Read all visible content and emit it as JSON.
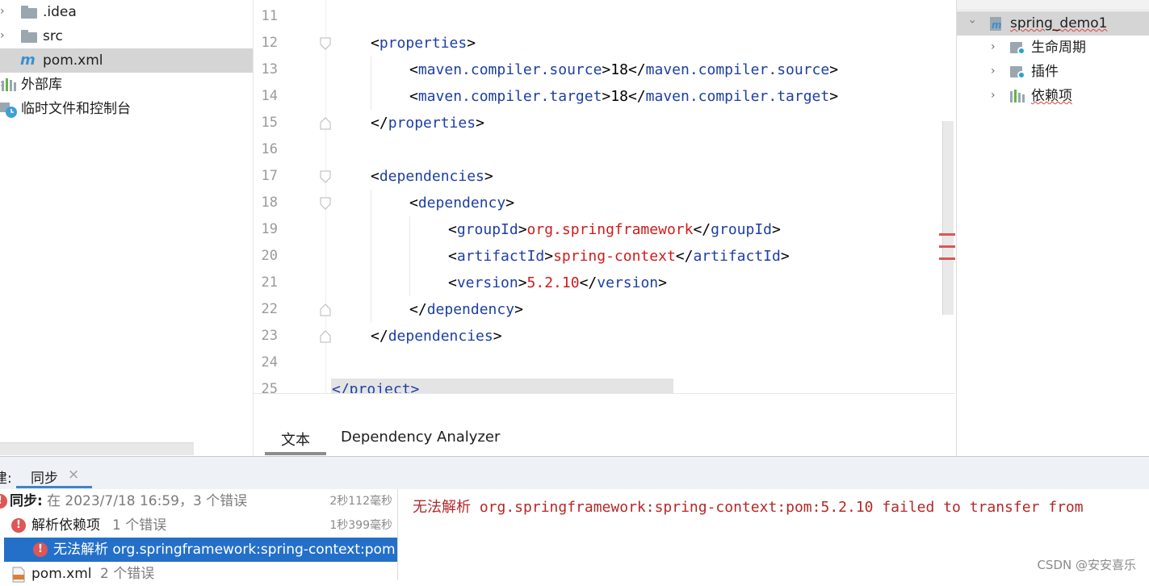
{
  "project_tree": {
    "items": [
      {
        "label": ".idea",
        "icon": "folder-icon"
      },
      {
        "label": "src",
        "icon": "folder-icon"
      },
      {
        "label": "pom.xml",
        "icon": "maven-file-icon"
      },
      {
        "label": "外部库",
        "icon": "library-icon"
      },
      {
        "label": "临时文件和控制台",
        "icon": "scratches-icon"
      }
    ]
  },
  "editor": {
    "line_numbers": [
      "11",
      "12",
      "13",
      "14",
      "15",
      "16",
      "17",
      "18",
      "19",
      "20",
      "21",
      "22",
      "23",
      "24",
      "25"
    ],
    "code": {
      "l12_tag": "properties",
      "l13_tag": "maven.compiler.source",
      "l13_val": "18",
      "l14_tag": "maven.compiler.target",
      "l14_val": "18",
      "l15_tag": "properties",
      "l17_tag": "dependencies",
      "l18_tag": "dependency",
      "l19_tag": "groupId",
      "l19_val": "org.springframework",
      "l20_tag": "artifactId",
      "l20_val": "spring-context",
      "l21_tag": "version",
      "l21_val": "5.2.10",
      "l22_tag": "dependency",
      "l23_tag": "dependencies",
      "l25_text": "</project>"
    },
    "tabs": {
      "text": "文本",
      "dependency_analyzer": "Dependency Analyzer"
    }
  },
  "maven_panel": {
    "project": "spring_demo1",
    "items": [
      {
        "label": "生命周期"
      },
      {
        "label": "插件"
      },
      {
        "label": "依赖项"
      }
    ]
  },
  "build_panel": {
    "header_prefix": "建:",
    "tab": "同步",
    "close_glyph": "×",
    "rows": {
      "sync_title": "同步:",
      "sync_detail": "在 2023/7/18 16:59，3 个错误",
      "sync_time": "2秒112毫秒",
      "resolve_title": "解析依赖项",
      "resolve_detail": "1 个错误",
      "resolve_time": "1秒399毫秒",
      "error_item": "无法解析 org.springframework:spring-context:pom",
      "pom_title": "pom.xml",
      "pom_detail": "2 个错误"
    },
    "console": {
      "prefix": "无法解析",
      "message": " org.springframework:spring-context:pom:5.2.10 failed to transfer from"
    },
    "watermark": "CSDN @安安喜乐"
  },
  "colors": {
    "xml_tag": "#1d3fa3",
    "xml_value": "#d11b1b",
    "selection": "#2470c9",
    "error": "#e05555"
  }
}
